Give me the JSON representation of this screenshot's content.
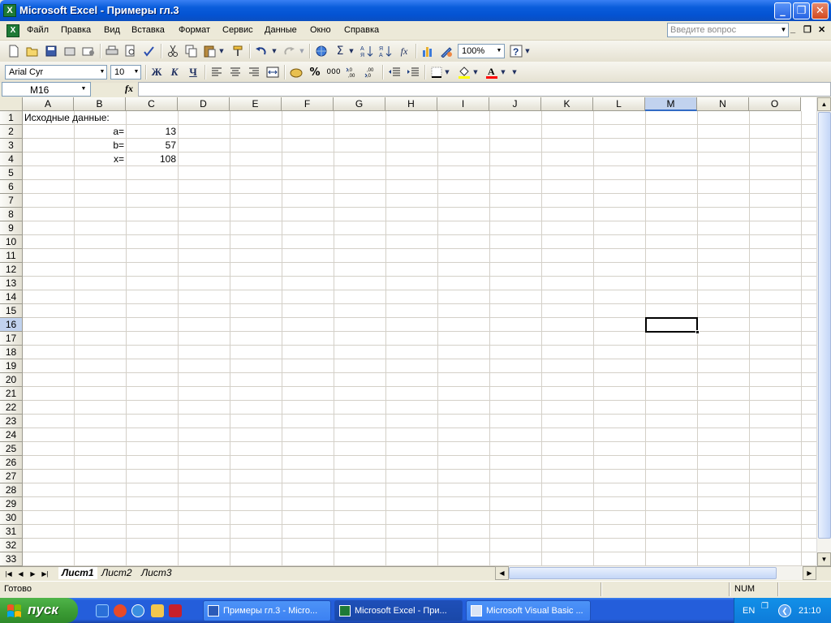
{
  "window": {
    "title": "Microsoft Excel - Примеры гл.3",
    "app_icon": "excel-icon",
    "min_label": "_",
    "restore_label": "❐",
    "close_label": "✕"
  },
  "menu": {
    "items": [
      "Файл",
      "Правка",
      "Вид",
      "Вставка",
      "Формат",
      "Сервис",
      "Данные",
      "Окно",
      "Справка"
    ],
    "help_placeholder": "Введите вопрос"
  },
  "toolbar": {
    "zoom": "100%",
    "font_name": "Arial Cyr",
    "font_size": "10",
    "bold_label": "Ж",
    "italic_label": "К",
    "underline_label": "Ч",
    "sigma_label": "Σ",
    "fx_label": "fx",
    "percent_label": "%",
    "thousands_label": "000"
  },
  "formula_bar": {
    "name_box": "M16",
    "fx_label": "fx",
    "formula": ""
  },
  "sheet": {
    "columns": [
      "A",
      "B",
      "C",
      "D",
      "E",
      "F",
      "G",
      "H",
      "I",
      "J",
      "K",
      "L",
      "M",
      "N",
      "O"
    ],
    "selected_column": "M",
    "selected_row": "16",
    "rows": [
      "1",
      "2",
      "3",
      "4",
      "5",
      "6",
      "7",
      "8",
      "9",
      "10",
      "11",
      "12",
      "13",
      "14",
      "15",
      "16",
      "17",
      "18",
      "19",
      "20",
      "21",
      "22",
      "23",
      "24",
      "25",
      "26",
      "27",
      "28",
      "29",
      "30",
      "31",
      "32",
      "33"
    ],
    "cells": {
      "A1": "Исходные данные:",
      "B2": "a=",
      "C2": "13",
      "B3": "b=",
      "C3": "57",
      "B4": "x=",
      "C4": "108"
    }
  },
  "tabs": [
    "Лист1",
    "Лист2",
    "Лист3"
  ],
  "active_tab": "Лист1",
  "status": {
    "text": "Готово",
    "num": "NUM"
  },
  "taskbar": {
    "start_label": "пуск",
    "tasks": [
      "Примеры гл.3 - Micro...",
      "Microsoft Excel - При...",
      "Microsoft Visual Basic ..."
    ],
    "active_task": "Microsoft Excel - При...",
    "lang": "EN",
    "clock": "21:10"
  }
}
